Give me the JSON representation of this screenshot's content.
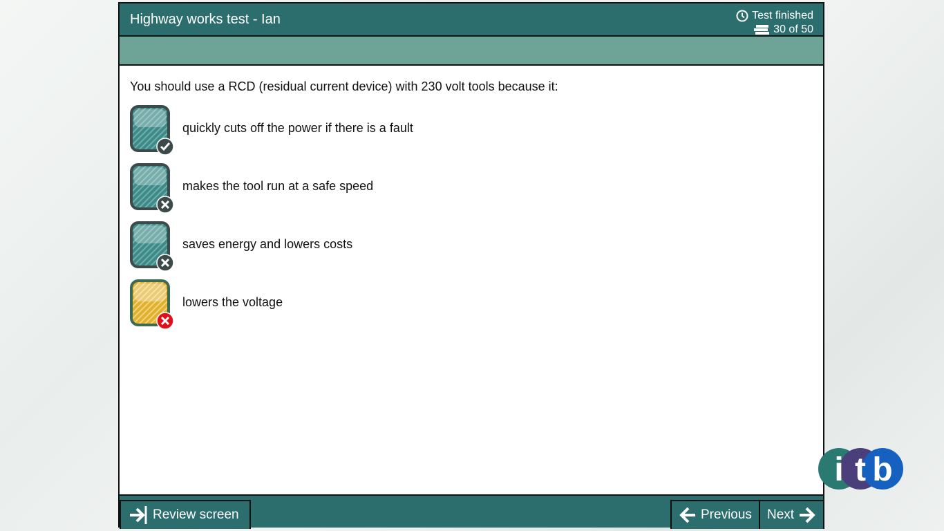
{
  "header": {
    "title": "Highway works test - Ian",
    "status_label": "Test finished",
    "progress_label": "30 of 50",
    "clock_icon": "clock-icon",
    "questions_icon": "question-stack-icon"
  },
  "question": {
    "text": "You should use a RCD (residual current device) with 230 volt tools because it:",
    "answers": [
      {
        "text": "quickly cuts off the power if there is a fault",
        "state": "correct-unselected",
        "badge": "check"
      },
      {
        "text": "makes the tool run at a safe speed",
        "state": "incorrect-unselected",
        "badge": "cross"
      },
      {
        "text": "saves energy and lowers costs",
        "state": "incorrect-unselected",
        "badge": "cross"
      },
      {
        "text": "lowers the voltage",
        "state": "incorrect-selected",
        "badge": "cross-red"
      }
    ]
  },
  "footer": {
    "review_label": "Review screen",
    "previous_label": "Previous",
    "next_label": "Next"
  },
  "logo": {
    "text_i": "i",
    "text_t": "t",
    "text_b": "b"
  },
  "colors": {
    "header": "#2c6e6e",
    "subbar": "#6ea398",
    "teal_answer": "#3f8a88",
    "selected_answer": "#e0b030",
    "wrong_badge": "#e0101a"
  }
}
